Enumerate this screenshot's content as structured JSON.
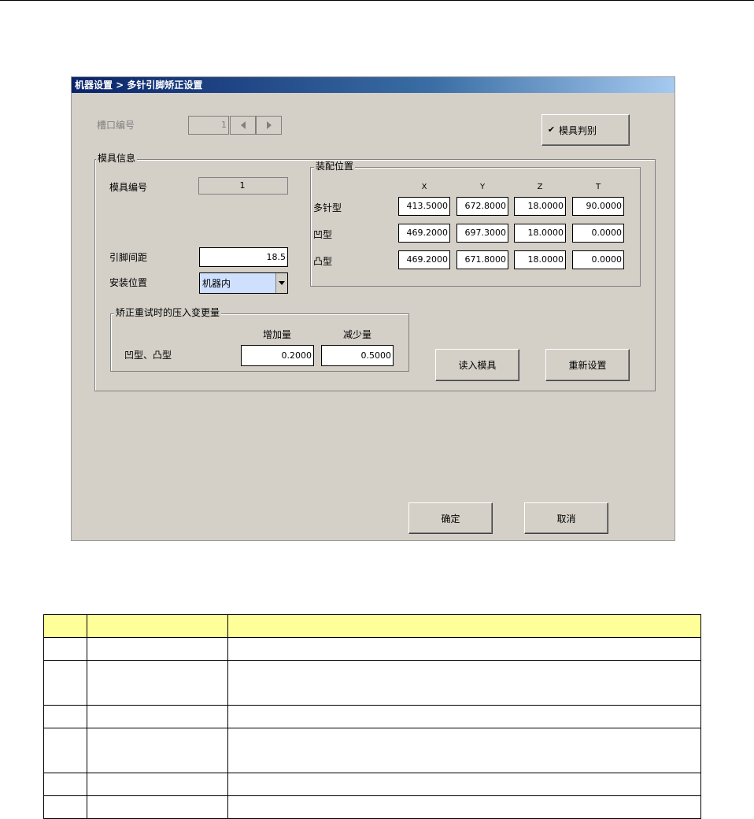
{
  "dialog": {
    "title": "机器设置 > 多针引脚矫正设置",
    "port_label": "槽口编号",
    "port_value": "1",
    "mold_check_label": "模具判别",
    "mold_check_mark": "✔",
    "mold_info_group": "模具信息",
    "mold_number_label": "模具编号",
    "mold_number_value": "1",
    "lead_pitch_label": "引脚间距",
    "lead_pitch_value": "18.5",
    "install_position_label": "安装位置",
    "install_position_value": "机器内",
    "assembly_group": "装配位置",
    "assembly_headers": [
      "X",
      "Y",
      "Z",
      "T"
    ],
    "assembly_rows": [
      {
        "label": "多针型",
        "values": [
          "413.5000",
          "672.8000",
          "18.0000",
          "90.0000"
        ]
      },
      {
        "label": "凹型",
        "values": [
          "469.2000",
          "697.3000",
          "18.0000",
          "0.0000"
        ]
      },
      {
        "label": "凸型",
        "values": [
          "469.2000",
          "671.8000",
          "18.0000",
          "0.0000"
        ]
      }
    ],
    "press_group": "矫正重试时的压入变更量",
    "increase_label": "增加量",
    "decrease_label": "减少量",
    "press_row_label": "凹型、凸型",
    "increase_value": "0.2000",
    "decrease_value": "0.5000",
    "read_mold_button": "读入模具",
    "reset_button": "重新设置",
    "ok_button": "确定",
    "cancel_button": "取消"
  },
  "colors": {
    "dialog_bg": "#d4d0c8",
    "title_bar_start": "#0a246a",
    "title_bar_end": "#a6caf0",
    "select_highlight": "#cfe0ff",
    "table_header": "#ffff99"
  }
}
